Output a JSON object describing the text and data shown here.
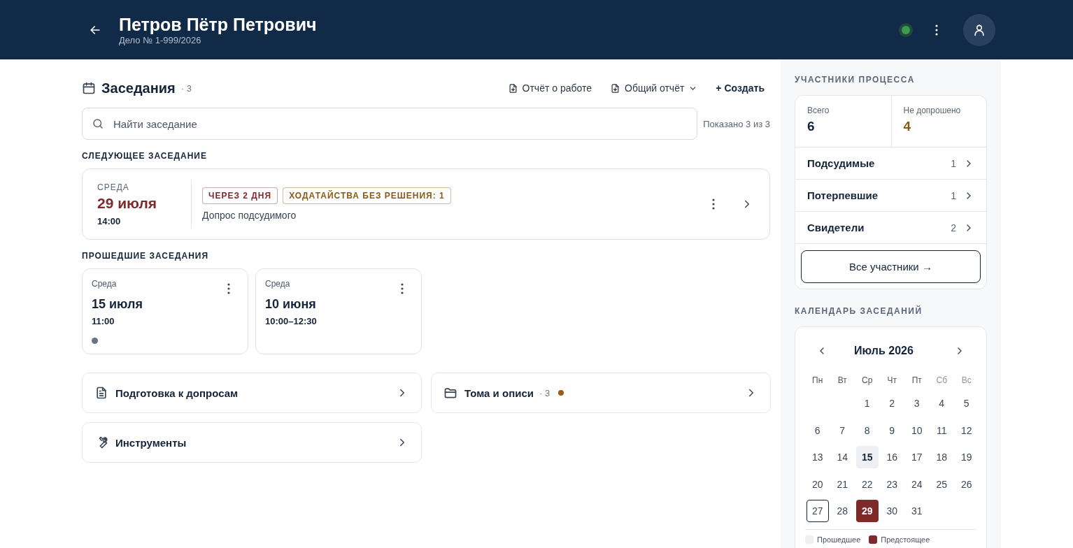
{
  "header": {
    "title": "Петров Пётр Петрович",
    "subtitle": "Дело № 1-999/2026",
    "online": true
  },
  "sessions": {
    "title": "Заседания",
    "count": "· 3",
    "actions": [
      {
        "kind": "report",
        "label": "Отчёт о работе",
        "dropdown": false
      },
      {
        "kind": "report",
        "label": "Общий отчёт",
        "dropdown": true
      },
      {
        "kind": "create",
        "label": "+ Создать",
        "dropdown": false
      }
    ],
    "search": {
      "placeholder": "Найти заседание"
    },
    "shown": "Показано 3 из 3",
    "next_label": "СЛЕДУЮЩЕЕ ЗАСЕДАНИЕ",
    "next": {
      "weekday": "СРЕДА",
      "date": "29 июля",
      "time": "14:00",
      "tags": [
        {
          "label": "ЧЕРЕЗ 2 ДНЯ",
          "color": "#7f2a2a"
        },
        {
          "label": "ХОДАТАЙСТВА БЕЗ РЕШЕНИЯ: 1",
          "color": "#8a5a12"
        }
      ],
      "description": "Допрос подсудимого"
    },
    "past_label": "ПРОШЕДШИЕ ЗАСЕДАНИЯ",
    "past": [
      {
        "weekday": "Среда",
        "date": "15 июля",
        "time": "11:00",
        "dot": true
      },
      {
        "weekday": "Среда",
        "date": "10 июня",
        "time": "10:00–12:30",
        "dot": false
      }
    ]
  },
  "links": [
    {
      "label": "Подготовка к допросам",
      "dot": false
    },
    {
      "label": "Тома и описи",
      "count": "· 3",
      "dot": true
    },
    {
      "label": "Инструменты",
      "dot": false
    }
  ],
  "participants": {
    "title": "УЧАСТНИКИ ПРОЦЕССА",
    "stats": [
      {
        "label": "Всего",
        "value": "6",
        "kind": "normal"
      },
      {
        "label": "Не допрошено",
        "value": "4",
        "kind": "warning"
      }
    ],
    "groups": [
      {
        "label": "Подсудимые",
        "count": "1"
      },
      {
        "label": "Потерпевшие",
        "count": "1"
      },
      {
        "label": "Свидетели",
        "count": "2"
      }
    ],
    "all_button": "Все участники →"
  },
  "calendar": {
    "title": "КАЛЕНДАРЬ ЗАСЕДАНИЙ",
    "month": "Июль 2026",
    "weekdays": [
      {
        "label": "Пн",
        "weekend": false
      },
      {
        "label": "Вт",
        "weekend": false
      },
      {
        "label": "Ср",
        "weekend": false
      },
      {
        "label": "Чт",
        "weekend": false
      },
      {
        "label": "Пт",
        "weekend": false
      },
      {
        "label": "Сб",
        "weekend": true
      },
      {
        "label": "Вс",
        "weekend": true
      }
    ],
    "weeks": [
      {
        "days": [
          {
            "day": "1",
            "kind": "plain"
          },
          {
            "day": "2",
            "kind": "plain"
          },
          {
            "day": "3",
            "kind": "plain"
          },
          {
            "day": "4",
            "kind": "plain"
          },
          {
            "day": "5",
            "kind": "plain"
          }
        ]
      },
      {
        "days": [
          {
            "day": "6",
            "kind": "plain"
          },
          {
            "day": "7",
            "kind": "plain"
          },
          {
            "day": "8",
            "kind": "plain"
          },
          {
            "day": "9",
            "kind": "plain"
          },
          {
            "day": "10",
            "kind": "plain"
          },
          {
            "day": "11",
            "kind": "plain"
          },
          {
            "day": "12",
            "kind": "plain"
          }
        ]
      },
      {
        "days": [
          {
            "day": "13",
            "kind": "plain"
          },
          {
            "day": "14",
            "kind": "plain"
          },
          {
            "day": "15",
            "kind": "past"
          },
          {
            "day": "16",
            "kind": "plain"
          },
          {
            "day": "17",
            "kind": "plain"
          },
          {
            "day": "18",
            "kind": "plain"
          },
          {
            "day": "19",
            "kind": "plain"
          }
        ]
      },
      {
        "days": [
          {
            "day": "20",
            "kind": "plain"
          },
          {
            "day": "21",
            "kind": "plain"
          },
          {
            "day": "22",
            "kind": "plain"
          },
          {
            "day": "23",
            "kind": "plain"
          },
          {
            "day": "24",
            "kind": "plain"
          },
          {
            "day": "25",
            "kind": "plain"
          },
          {
            "day": "26",
            "kind": "plain"
          }
        ]
      },
      {
        "days": [
          {
            "day": "27",
            "kind": "today"
          },
          {
            "day": "28",
            "kind": "plain"
          },
          {
            "day": "29",
            "kind": "upcoming"
          },
          {
            "day": "30",
            "kind": "plain"
          },
          {
            "day": "31",
            "kind": "plain"
          }
        ]
      }
    ],
    "legend": [
      {
        "kind": "past",
        "label": "Прошедшее"
      },
      {
        "kind": "upcoming",
        "label": "Предстоящее"
      }
    ]
  }
}
